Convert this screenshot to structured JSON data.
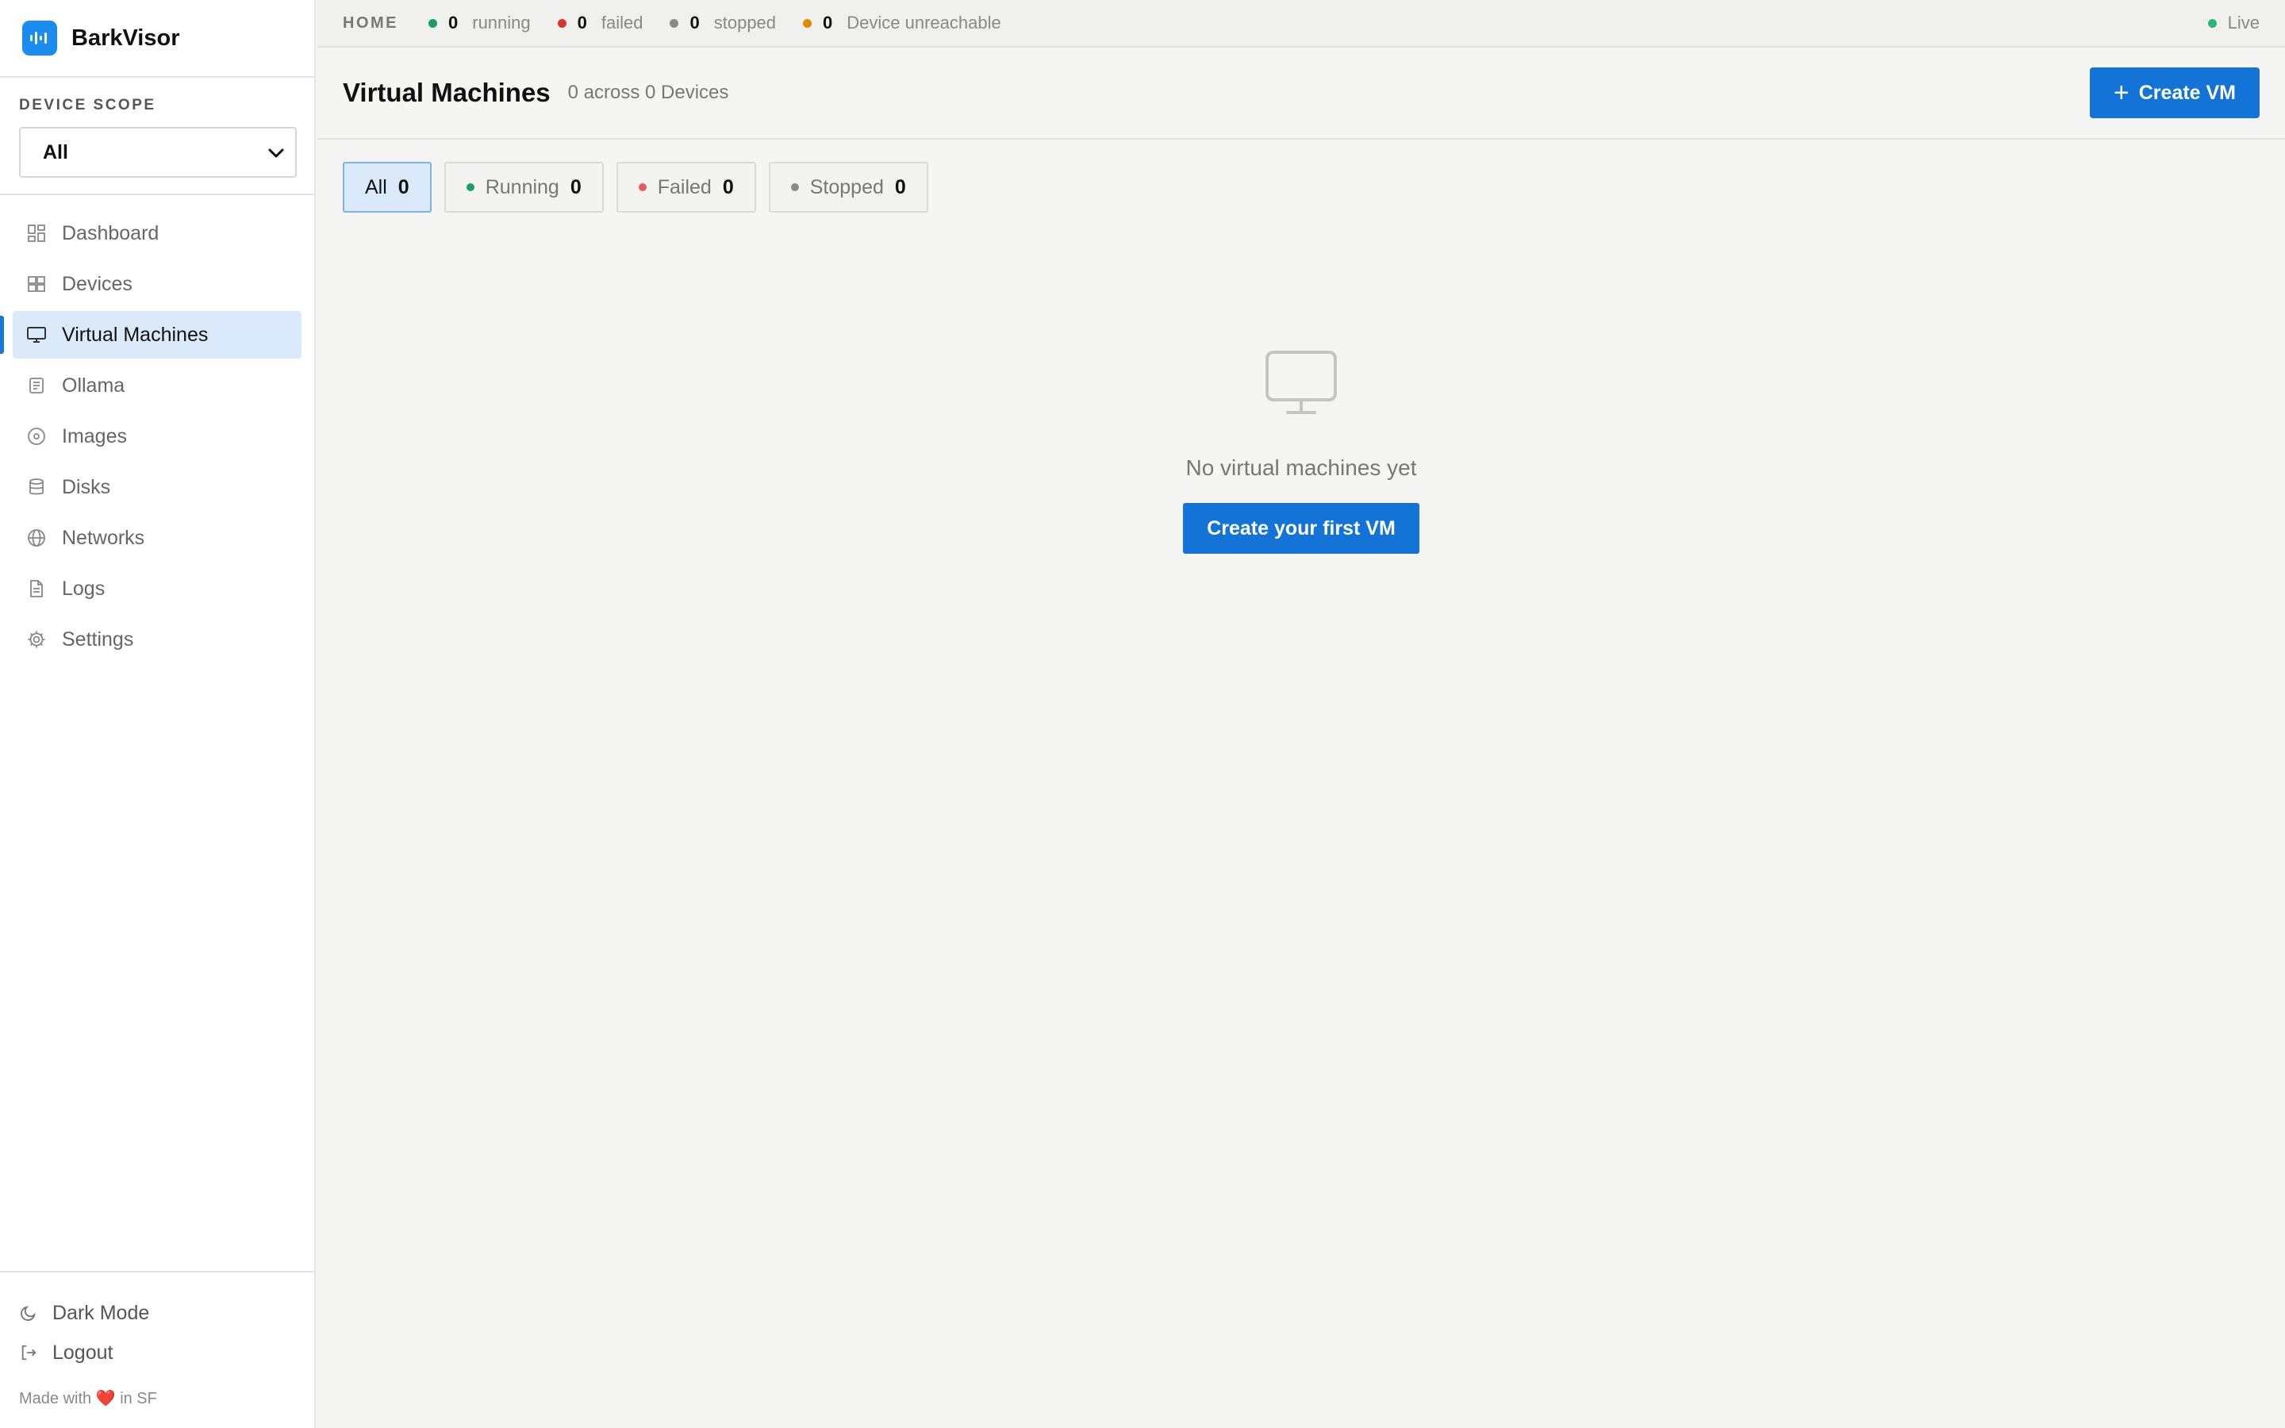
{
  "app": {
    "name": "BarkVisor",
    "colors": {
      "accent": "#1373d6",
      "running": "#1a9e62",
      "failed": "#d9342b",
      "stopped": "#8a8a8a",
      "unreachable": "#e08a00",
      "live": "#2bb673"
    }
  },
  "sidebar": {
    "scope_label": "DEVICE SCOPE",
    "scope_value": "All",
    "items": [
      {
        "label": "Dashboard",
        "icon": "grid-icon"
      },
      {
        "label": "Devices",
        "icon": "devices-icon"
      },
      {
        "label": "Virtual Machines",
        "icon": "monitor-icon",
        "active": true
      },
      {
        "label": "Ollama",
        "icon": "ollama-icon"
      },
      {
        "label": "Images",
        "icon": "disc-icon"
      },
      {
        "label": "Disks",
        "icon": "database-icon"
      },
      {
        "label": "Networks",
        "icon": "globe-icon"
      },
      {
        "label": "Logs",
        "icon": "file-icon"
      },
      {
        "label": "Settings",
        "icon": "gear-icon"
      }
    ],
    "footer": {
      "dark_mode": "Dark Mode",
      "logout": "Logout",
      "made_prefix": "Made with",
      "made_suffix": "in SF"
    }
  },
  "topbar": {
    "crumb": "HOME",
    "stats": [
      {
        "count": "0",
        "label": "running",
        "color": "#1a9e62"
      },
      {
        "count": "0",
        "label": "failed",
        "color": "#d9342b"
      },
      {
        "count": "0",
        "label": "stopped",
        "color": "#8a8a8a"
      },
      {
        "count": "0",
        "label": "Device unreachable",
        "color": "#e08a00"
      }
    ],
    "live": "Live"
  },
  "header": {
    "title": "Virtual Machines",
    "subtitle": "0 across 0 Devices",
    "create_label": "Create VM"
  },
  "filters": [
    {
      "label": "All",
      "count": "0",
      "active": true
    },
    {
      "label": "Running",
      "count": "0",
      "color": "#1a9e62"
    },
    {
      "label": "Failed",
      "count": "0",
      "color": "#e06060"
    },
    {
      "label": "Stopped",
      "count": "0",
      "color": "#8a8a8a"
    }
  ],
  "empty": {
    "message": "No virtual machines yet",
    "cta": "Create your first VM"
  }
}
